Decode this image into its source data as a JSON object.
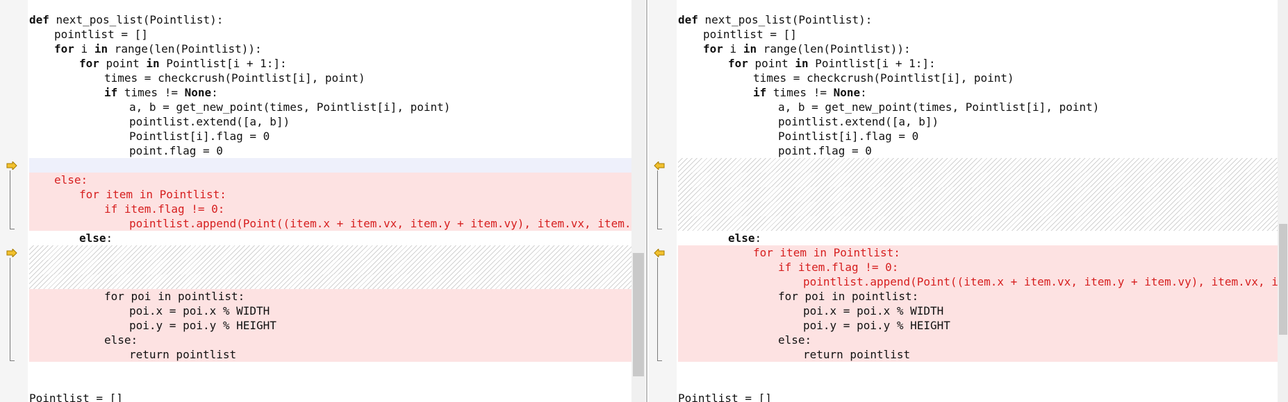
{
  "left_pane": {
    "lines": [
      {
        "indent": 0,
        "parts": [
          {
            "t": "def",
            "kw": true
          },
          {
            "t": " next_pos_list(Pointlist):"
          }
        ]
      },
      {
        "indent": 1,
        "parts": [
          {
            "t": "pointlist = []"
          }
        ]
      },
      {
        "indent": 1,
        "parts": [
          {
            "t": "for",
            "kw": true
          },
          {
            "t": " i "
          },
          {
            "t": "in",
            "kw": true
          },
          {
            "t": " range(len(Pointlist)):"
          }
        ]
      },
      {
        "indent": 2,
        "parts": [
          {
            "t": "for",
            "kw": true
          },
          {
            "t": " point "
          },
          {
            "t": "in",
            "kw": true
          },
          {
            "t": " Pointlist[i + 1:]:"
          }
        ]
      },
      {
        "indent": 3,
        "parts": [
          {
            "t": "times = checkcrush(Pointlist[i], point)"
          }
        ]
      },
      {
        "indent": 3,
        "parts": [
          {
            "t": "if",
            "kw": true
          },
          {
            "t": " times != "
          },
          {
            "t": "None",
            "kw": true
          },
          {
            "t": ":"
          }
        ]
      },
      {
        "indent": 4,
        "parts": [
          {
            "t": "a, b = get_new_point(times, Pointlist[i], point)"
          }
        ]
      },
      {
        "indent": 4,
        "parts": [
          {
            "t": "pointlist.extend([a, b])"
          }
        ]
      },
      {
        "indent": 4,
        "parts": [
          {
            "t": "Pointlist[i].flag = 0"
          }
        ]
      },
      {
        "indent": 4,
        "parts": [
          {
            "t": "point.flag = 0"
          }
        ]
      },
      {
        "indent": 0,
        "bg": "blue",
        "parts": []
      },
      {
        "indent": 1,
        "bg": "del",
        "red": true,
        "parts": [
          {
            "t": "else:"
          }
        ]
      },
      {
        "indent": 2,
        "bg": "del",
        "red": true,
        "parts": [
          {
            "t": "for item in Pointlist:"
          }
        ]
      },
      {
        "indent": 3,
        "bg": "del",
        "red": true,
        "parts": [
          {
            "t": "if item.flag != 0:"
          }
        ]
      },
      {
        "indent": 4,
        "bg": "del",
        "red": true,
        "parts": [
          {
            "t": "pointlist.append(Point((item.x + item.vx, item.y + item.vy), item.vx, item.vy))"
          }
        ]
      },
      {
        "indent": 2,
        "parts": [
          {
            "t": "else",
            "kw": true
          },
          {
            "t": ":"
          }
        ]
      },
      {
        "indent": 0,
        "bg": "hatch",
        "parts": []
      },
      {
        "indent": 0,
        "bg": "hatch",
        "parts": []
      },
      {
        "indent": 0,
        "bg": "hatch",
        "parts": []
      },
      {
        "indent": 3,
        "bg": "del",
        "parts": [
          {
            "t": "for poi in pointlist:"
          }
        ]
      },
      {
        "indent": 4,
        "bg": "del",
        "parts": [
          {
            "t": "poi.x = poi.x % WIDTH"
          }
        ]
      },
      {
        "indent": 4,
        "bg": "del",
        "parts": [
          {
            "t": "poi.y = poi.y % HEIGHT"
          }
        ]
      },
      {
        "indent": 3,
        "bg": "del",
        "parts": [
          {
            "t": "else:"
          }
        ]
      },
      {
        "indent": 4,
        "bg": "del",
        "parts": [
          {
            "t": "return pointlist"
          }
        ]
      },
      {
        "indent": 0,
        "parts": []
      },
      {
        "indent": 0,
        "parts": []
      },
      {
        "indent": 0,
        "parts": [
          {
            "t": "Pointlist = []"
          }
        ]
      }
    ]
  },
  "right_pane": {
    "lines": [
      {
        "indent": 0,
        "parts": [
          {
            "t": "def",
            "kw": true
          },
          {
            "t": " next_pos_list(Pointlist):"
          }
        ]
      },
      {
        "indent": 1,
        "parts": [
          {
            "t": "pointlist = []"
          }
        ]
      },
      {
        "indent": 1,
        "parts": [
          {
            "t": "for",
            "kw": true
          },
          {
            "t": " i "
          },
          {
            "t": "in",
            "kw": true
          },
          {
            "t": " range(len(Pointlist)):"
          }
        ]
      },
      {
        "indent": 2,
        "parts": [
          {
            "t": "for",
            "kw": true
          },
          {
            "t": " point "
          },
          {
            "t": "in",
            "kw": true
          },
          {
            "t": " Pointlist[i + 1:]:"
          }
        ]
      },
      {
        "indent": 3,
        "parts": [
          {
            "t": "times = checkcrush(Pointlist[i], point)"
          }
        ]
      },
      {
        "indent": 3,
        "parts": [
          {
            "t": "if",
            "kw": true
          },
          {
            "t": " times != "
          },
          {
            "t": "None",
            "kw": true
          },
          {
            "t": ":"
          }
        ]
      },
      {
        "indent": 4,
        "parts": [
          {
            "t": "a, b = get_new_point(times, Pointlist[i], point)"
          }
        ]
      },
      {
        "indent": 4,
        "parts": [
          {
            "t": "pointlist.extend([a, b])"
          }
        ]
      },
      {
        "indent": 4,
        "parts": [
          {
            "t": "Pointlist[i].flag = 0"
          }
        ]
      },
      {
        "indent": 4,
        "parts": [
          {
            "t": "point.flag = 0"
          }
        ]
      },
      {
        "indent": 0,
        "bg": "hatch",
        "parts": []
      },
      {
        "indent": 0,
        "bg": "hatch",
        "parts": []
      },
      {
        "indent": 0,
        "bg": "hatch",
        "parts": []
      },
      {
        "indent": 0,
        "bg": "hatch",
        "parts": []
      },
      {
        "indent": 0,
        "bg": "hatch",
        "parts": []
      },
      {
        "indent": 2,
        "parts": [
          {
            "t": "else",
            "kw": true
          },
          {
            "t": ":"
          }
        ]
      },
      {
        "indent": 3,
        "bg": "del",
        "red": true,
        "parts": [
          {
            "t": "for item in Pointlist:"
          }
        ]
      },
      {
        "indent": 4,
        "bg": "del",
        "red": true,
        "parts": [
          {
            "t": "if item.flag != 0:"
          }
        ]
      },
      {
        "indent": 5,
        "bg": "del",
        "red": true,
        "parts": [
          {
            "t": "pointlist.append(Point((item.x + item.vx, item.y + item.vy), item.vx, item.vy))"
          }
        ]
      },
      {
        "indent": 4,
        "bg": "del",
        "parts": [
          {
            "t": "for poi in pointlist:"
          }
        ]
      },
      {
        "indent": 5,
        "bg": "del",
        "parts": [
          {
            "t": "poi.x = poi.x % WIDTH"
          }
        ]
      },
      {
        "indent": 5,
        "bg": "del",
        "parts": [
          {
            "t": "poi.y = poi.y % HEIGHT"
          }
        ]
      },
      {
        "indent": 4,
        "bg": "del",
        "parts": [
          {
            "t": "else:"
          }
        ]
      },
      {
        "indent": 5,
        "bg": "del",
        "parts": [
          {
            "t": "return pointlist"
          }
        ]
      },
      {
        "indent": 0,
        "parts": []
      },
      {
        "indent": 0,
        "parts": []
      },
      {
        "indent": 0,
        "parts": [
          {
            "t": "Pointlist = []"
          }
        ]
      }
    ]
  },
  "markers": {
    "left_arrow_icon": "arrow-right-icon",
    "right_arrow_icon": "arrow-left-icon",
    "arrow_color": "#f2c12e",
    "deleted_bg": "#fde2e2",
    "deleted_text": "#d61f1f"
  }
}
